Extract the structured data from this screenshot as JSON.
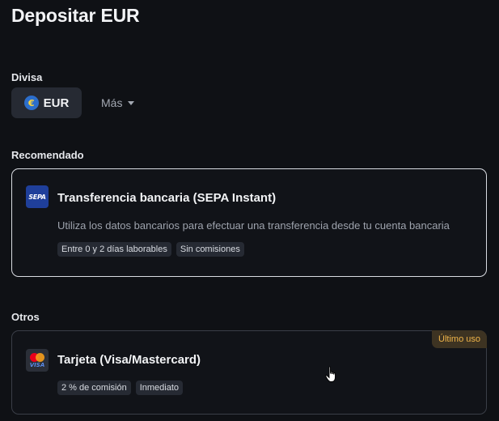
{
  "page": {
    "title": "Depositar EUR"
  },
  "currency": {
    "section_label": "Divisa",
    "selected": {
      "label": "EUR",
      "icon": "euro-coin-icon",
      "symbol": "€"
    },
    "more_label": "Más",
    "more_icon": "caret-down-icon"
  },
  "recommended": {
    "section_label": "Recomendado",
    "method": {
      "icon": "sepa-icon",
      "icon_text": "SEPA",
      "title": "Transferencia bancaria (SEPA Instant)",
      "description": "Utiliza los datos bancarios para efectuar una transferencia desde tu cuenta bancaria",
      "tags": [
        "Entre 0 y 2 días laborables",
        "Sin comisiones"
      ]
    }
  },
  "others": {
    "section_label": "Otros",
    "methods": [
      {
        "icon": "visa-mastercard-icon",
        "icon_text": "VISA",
        "title": "Tarjeta (Visa/Mastercard)",
        "badge": "Último uso",
        "tags": [
          "2 % de comisión",
          "Inmediato"
        ]
      }
    ]
  },
  "colors": {
    "background": "#0f1115",
    "card_border_selected": "#d9dce2",
    "badge_text": "#f0b54a",
    "sepa_blue": "#1f3f9a"
  }
}
